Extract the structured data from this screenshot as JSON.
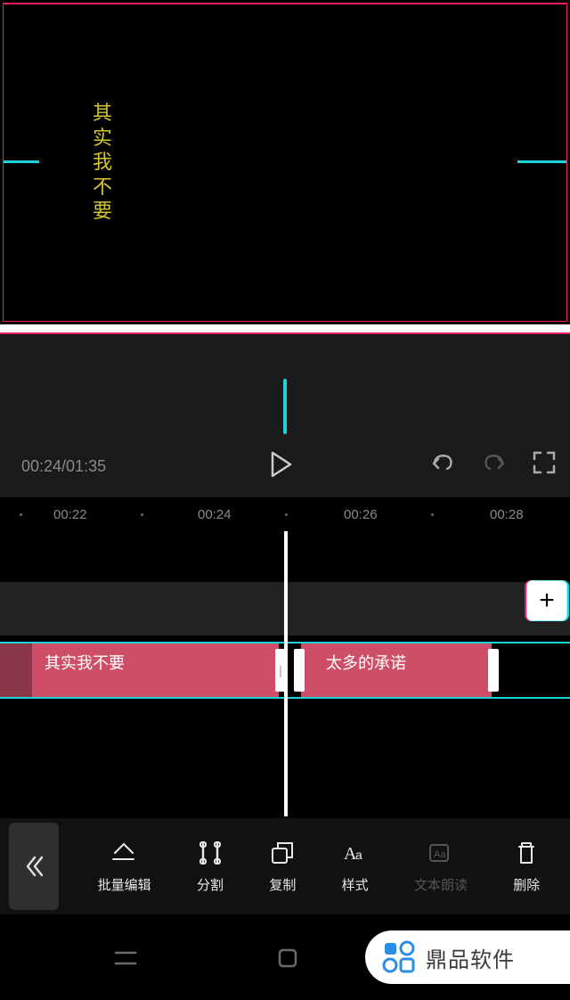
{
  "preview": {
    "vertical_text": [
      "其",
      "实",
      "我",
      "不",
      "要"
    ]
  },
  "playback": {
    "time_display": "00:24/01:35"
  },
  "ruler": {
    "t1": "00:22",
    "t2": "00:24",
    "t3": "00:26",
    "t4": "00:28"
  },
  "timeline": {
    "segment1_text": "其实我不要",
    "segment2_text": "太多的承诺",
    "add_label": "+"
  },
  "toolbar": {
    "batch_edit": "批量编辑",
    "split": "分割",
    "copy": "复制",
    "style": "样式",
    "tts": "文本朗读",
    "delete": "删除"
  },
  "watermark": {
    "text": "鼎品软件"
  }
}
